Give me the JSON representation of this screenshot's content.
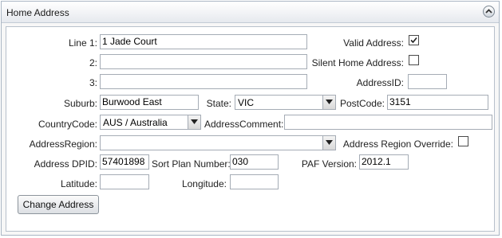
{
  "panel": {
    "title": "Home Address",
    "collapse_icon": "chevron-up-circle-icon"
  },
  "form": {
    "line1_label": "Line 1:",
    "line1_value": "1 Jade Court",
    "line2_label": "2:",
    "line2_value": "",
    "line3_label": "3:",
    "line3_value": "",
    "valid_address_label": "Valid Address:",
    "valid_address_checked": true,
    "silent_home_label": "Silent Home Address:",
    "silent_home_checked": false,
    "address_id_label": "AddressID:",
    "address_id_value": "",
    "suburb_label": "Suburb:",
    "suburb_value": "Burwood East",
    "state_label": "State:",
    "state_value": "VIC",
    "postcode_label": "PostCode:",
    "postcode_value": "3151",
    "country_label": "CountryCode:",
    "country_value": "AUS / Australia",
    "comment_label": "AddressComment:",
    "comment_value": "",
    "region_label": "AddressRegion:",
    "region_value": "",
    "region_override_label": "Address Region Override:",
    "region_override_checked": false,
    "dpid_label": "Address DPID:",
    "dpid_value": "57401898",
    "sort_plan_label": "Sort Plan Number:",
    "sort_plan_value": "030",
    "paf_label": "PAF Version:",
    "paf_value": "2012.1",
    "latitude_label": "Latitude:",
    "latitude_value": "",
    "longitude_label": "Longitude:",
    "longitude_value": ""
  },
  "actions": {
    "change_address_label": "Change Address"
  }
}
